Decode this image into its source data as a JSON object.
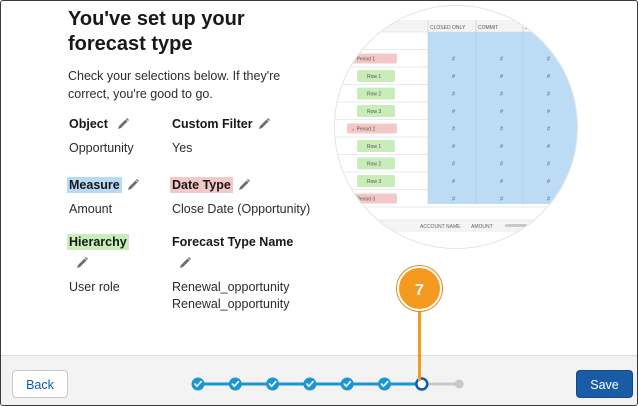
{
  "page": {
    "title": "You've set up your forecast type",
    "description": "Check your selections below. If they're correct, you're good to go."
  },
  "fields": [
    {
      "label": "Object",
      "value": "Opportunity",
      "highlight": "none"
    },
    {
      "label": "Custom Filter",
      "value": "Yes",
      "highlight": "none"
    },
    {
      "label": "Measure",
      "value": "Amount",
      "highlight": "#b9daf5"
    },
    {
      "label": "Date Type",
      "value": "Close Date (Opportunity)",
      "highlight": "#f5c8c8"
    },
    {
      "label": "Hierarchy",
      "value": "User role",
      "highlight": "#c9ecb8"
    },
    {
      "label": "Forecast Type Name",
      "value": "Renewal_opportunity",
      "value2": "Renewal_opportunity",
      "highlight": "none"
    }
  ],
  "preview": {
    "col_headers": [
      "CLOSED ONLY",
      "COMMIT",
      "BE"
    ],
    "rows": [
      {
        "label": "S",
        "type": "header"
      },
      {
        "label": "Period 1",
        "type": "period"
      },
      {
        "label": "Row 1",
        "type": "row"
      },
      {
        "label": "Row 2",
        "type": "row"
      },
      {
        "label": "Row 3",
        "type": "row"
      },
      {
        "label": "Period 2",
        "type": "period"
      },
      {
        "label": "Row 1",
        "type": "row"
      },
      {
        "label": "Row 2",
        "type": "row"
      },
      {
        "label": "Row 3",
        "type": "row"
      },
      {
        "label": "Period 3",
        "type": "period"
      }
    ],
    "cell_symbol": "#",
    "bottom_headers": [
      "S",
      "ACCOUNT NAME",
      "AMOUNT"
    ]
  },
  "callout": {
    "number": "7",
    "color": "#f49b1f"
  },
  "progress": {
    "total_steps": 8,
    "completed_steps": 6,
    "current_step": 7
  },
  "footer": {
    "back_label": "Back",
    "save_label": "Save"
  },
  "colors": {
    "accent": "#1a5ba6",
    "step": "#1b96d4",
    "callout": "#f49b1f"
  }
}
